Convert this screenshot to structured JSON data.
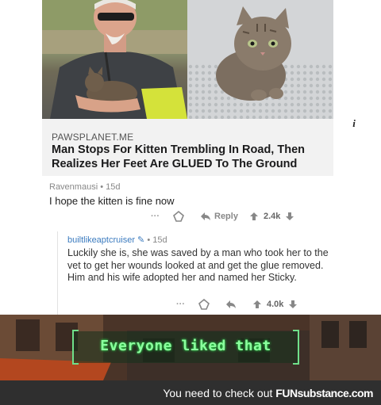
{
  "article": {
    "source": "PAWSPLANET.ME",
    "headline": "Man Stops For Kitten Trembling In Road, Then Realizes Her Feet Are GLUED To The Ground",
    "info_icon": "info-icon"
  },
  "comment1": {
    "author": "Ravenmausi",
    "age": "15d",
    "text": "I hope the kitten is fine now",
    "reply_label": "Reply",
    "score": "2.4k"
  },
  "comment2": {
    "author": "builtlikeaptcruiser",
    "age": "15d",
    "text": "Luckily she is, she was saved by a man who took her to the vet to get her wounds looked at and get the glue removed. Him and his wife adopted her and named her Sticky.",
    "score": "4.0k"
  },
  "scene": {
    "notification": "Everyone liked that",
    "accent": "#8bff9e"
  },
  "footer": {
    "prefix": "You need to check out",
    "brand_a": "FUN",
    "brand_b": "substance",
    "brand_c": ".com"
  }
}
